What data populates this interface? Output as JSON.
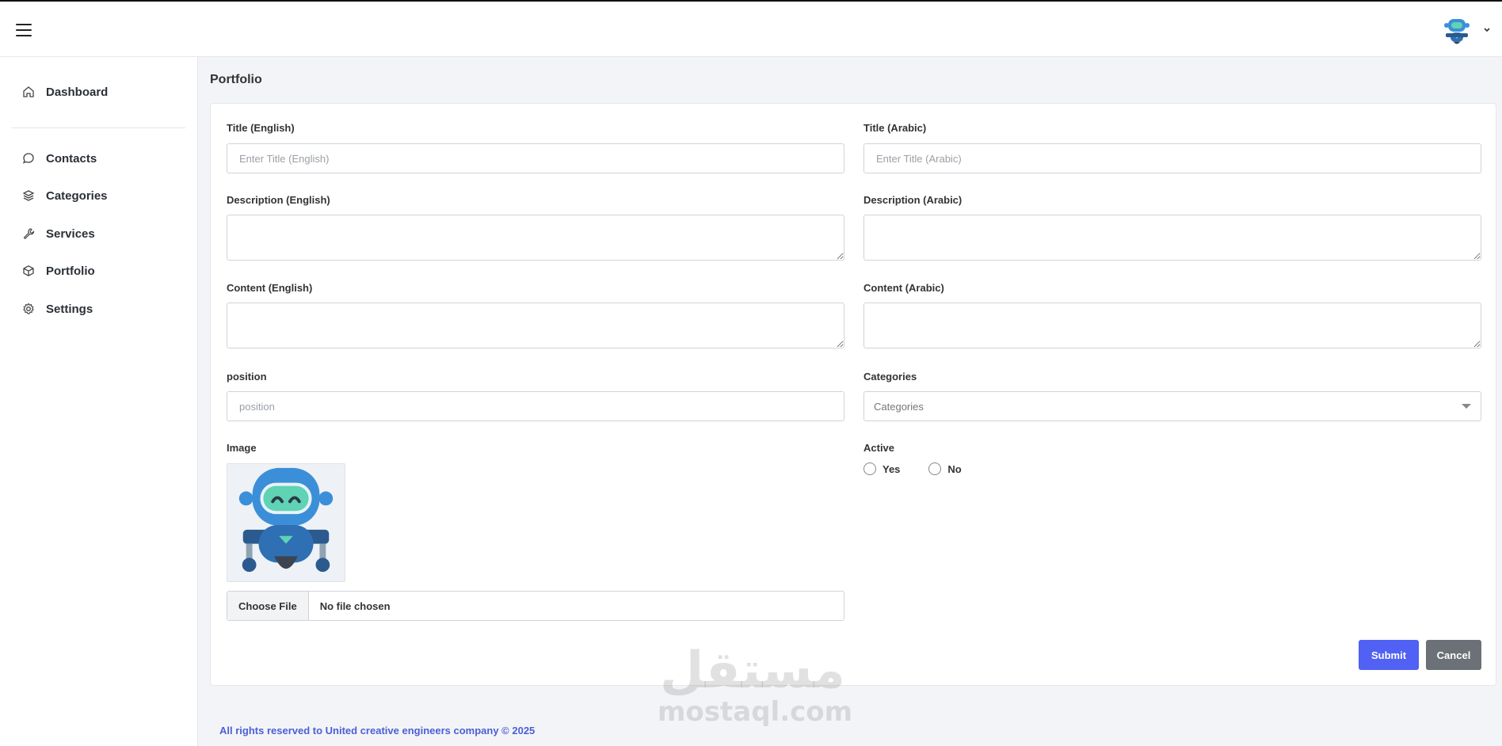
{
  "sidebar": {
    "items": [
      {
        "label": "Dashboard",
        "icon": "home-icon"
      },
      {
        "label": "Contacts",
        "icon": "chat-bubble-icon"
      },
      {
        "label": "Categories",
        "icon": "layers-icon"
      },
      {
        "label": "Services",
        "icon": "wrench-icon"
      },
      {
        "label": "Portfolio",
        "icon": "box-icon"
      },
      {
        "label": "Settings",
        "icon": "gear-icon"
      }
    ]
  },
  "page": {
    "title": "Portfolio"
  },
  "form": {
    "title_en": {
      "label": "Title (English)",
      "placeholder": "Enter Title (English)",
      "value": ""
    },
    "title_ar": {
      "label": "Title (Arabic)",
      "placeholder": "Enter Title (Arabic)",
      "value": ""
    },
    "description_en": {
      "label": "Description (English)",
      "value": ""
    },
    "description_ar": {
      "label": "Description (Arabic)",
      "value": ""
    },
    "content_en": {
      "label": "Content (English)",
      "value": ""
    },
    "content_ar": {
      "label": "Content (Arabic)",
      "value": ""
    },
    "position": {
      "label": "position",
      "placeholder": "position",
      "value": ""
    },
    "categories": {
      "label": "Categories",
      "selected": "Categories"
    },
    "image": {
      "label": "Image",
      "choose_label": "Choose File",
      "status": "No file chosen"
    },
    "active": {
      "label": "Active",
      "yes_label": "Yes",
      "no_label": "No"
    },
    "submit_label": "Submit",
    "cancel_label": "Cancel"
  },
  "footer": {
    "text": "All rights reserved to United creative engineers company © 2025"
  },
  "watermark": {
    "arabic": "مستقل",
    "latin": "mostaql.com"
  },
  "colors": {
    "accent": "#5061f3",
    "cancel": "#6b7177",
    "footer_text": "#4c5fd5",
    "robot_blue": "#3b8fd8",
    "robot_teal": "#5fd3b4"
  }
}
